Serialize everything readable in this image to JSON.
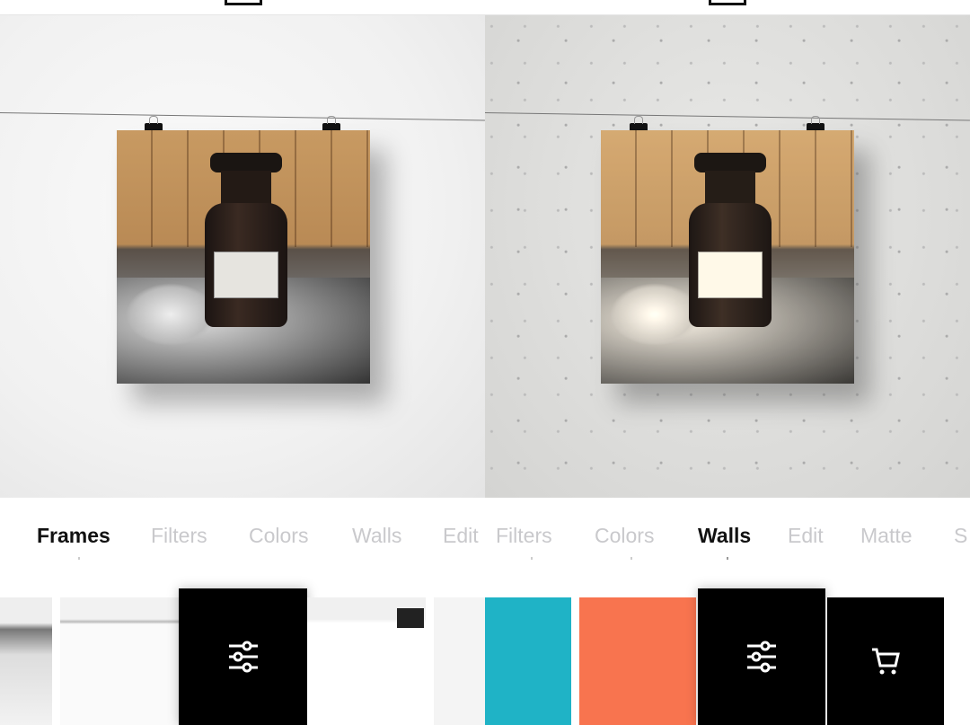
{
  "top_icons": [
    "frame-icon",
    "frame-icon"
  ],
  "left_screen": {
    "tabs": [
      {
        "label": "Frames",
        "active": true
      },
      {
        "label": "Filters",
        "active": false
      },
      {
        "label": "Colors",
        "active": false
      },
      {
        "label": "Walls",
        "active": false
      },
      {
        "label": "Edit",
        "active": false
      }
    ],
    "thumbnails": [
      "frame-style",
      "frame-style",
      "adjust-sliders-icon",
      "frame-clip-style",
      "frame-style"
    ]
  },
  "right_screen": {
    "tabs": [
      {
        "label": "Filters",
        "active": false
      },
      {
        "label": "Colors",
        "active": false
      },
      {
        "label": "Walls",
        "active": true
      },
      {
        "label": "Edit",
        "active": false
      },
      {
        "label": "Matte",
        "active": false
      },
      {
        "label": "S",
        "active": false
      }
    ],
    "thumbnails": [
      "wall-cyan",
      "wall-orange",
      "adjust-sliders-icon",
      "cart-icon"
    ],
    "colors": {
      "cyan": "#1fb3c6",
      "orange": "#f8744f"
    }
  }
}
